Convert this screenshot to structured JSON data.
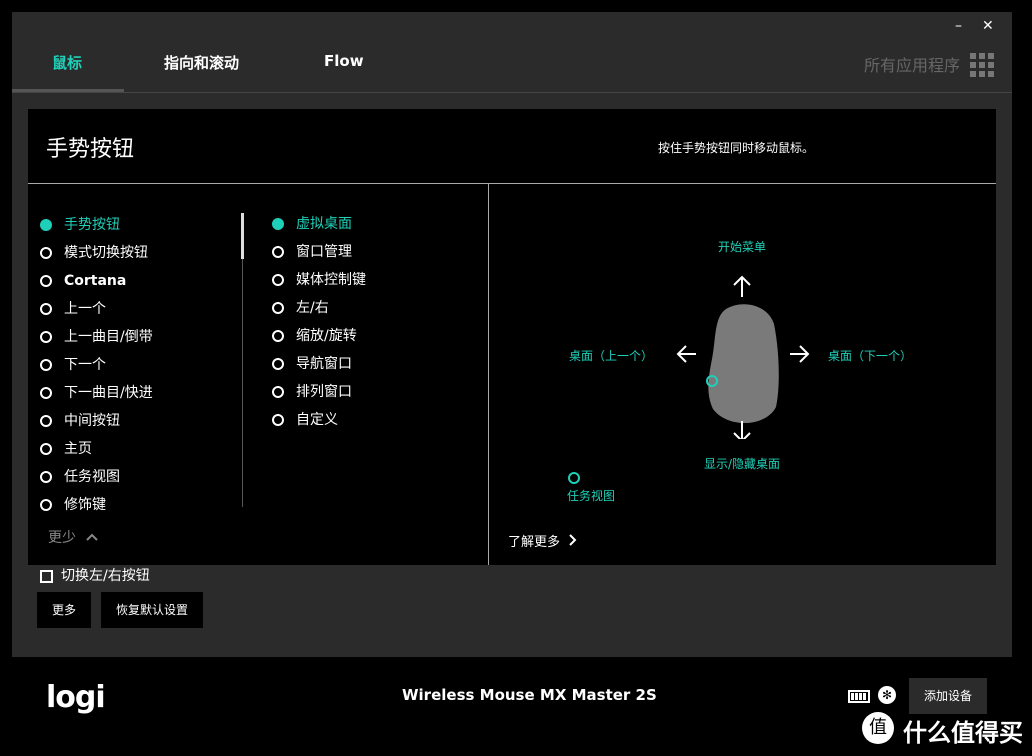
{
  "window": {
    "minimize": "–",
    "close": "✕"
  },
  "tabs": [
    {
      "label": "鼠标",
      "active": true
    },
    {
      "label": "指向和滚动",
      "active": false
    },
    {
      "label": "Flow",
      "active": false
    }
  ],
  "all_apps_label": "所有应用程序",
  "panel": {
    "title": "手势按钮",
    "hint": "按住手势按钮同时移动鼠标。",
    "left_list": [
      "手势按钮",
      "模式切换按钮",
      "Cortana",
      "上一个",
      "上一曲目/倒带",
      "下一个",
      "下一曲目/快进",
      "中间按钮",
      "主页",
      "任务视图",
      "修饰键"
    ],
    "right_list": [
      "虚拟桌面",
      "窗口管理",
      "媒体控制键",
      "左/右",
      "缩放/旋转",
      "导航窗口",
      "排列窗口",
      "自定义"
    ],
    "less_label": "更少",
    "learn_more": "了解更多",
    "gesture": {
      "up": "开始菜单",
      "left": "桌面（上一个）",
      "right": "桌面（下一个）",
      "down": "显示/隐藏桌面",
      "click": "任务视图"
    }
  },
  "swap_buttons_label": "切换左/右按钮",
  "buttons": {
    "more": "更多",
    "restore": "恢复默认设置"
  },
  "footer": {
    "logo": "logi",
    "device_name": "Wireless Mouse MX Master 2S",
    "add_device": "添加设备",
    "watermark": "什么值得买"
  },
  "colors": {
    "accent": "#1fd0b8",
    "window_bg": "#2b2b2b",
    "panel_bg": "#000000"
  }
}
